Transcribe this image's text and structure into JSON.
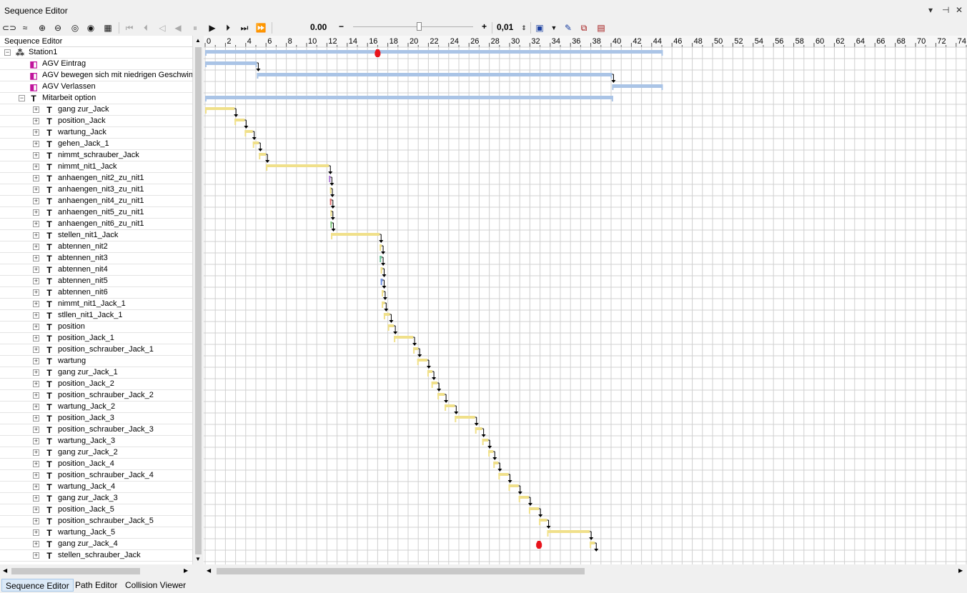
{
  "window": {
    "title": "Sequence Editor",
    "controls": [
      "▾",
      "⊣",
      "✕"
    ]
  },
  "toolbar": {
    "time_value": "0.00",
    "minus_label": "−",
    "plus_label": "+",
    "step_value": "0,01"
  },
  "tree": {
    "header": "Sequence Editor",
    "rows": [
      {
        "label": "Station1",
        "icon": "station-icon",
        "indent": 0,
        "exp": "−"
      },
      {
        "label": "AGV Eintrag",
        "icon": "agv-operation-icon",
        "indent": 2,
        "exp": ""
      },
      {
        "label": "AGV bewegen sich mit niedrigen Geschwin",
        "icon": "agv-operation-icon",
        "indent": 2,
        "exp": ""
      },
      {
        "label": "AGV Verlassen",
        "icon": "agv-operation-icon",
        "indent": 2,
        "exp": ""
      },
      {
        "label": "Mitarbeit option",
        "icon": "task-icon",
        "indent": 1,
        "exp": "−"
      },
      {
        "label": "gang zur_Jack",
        "icon": "task-icon",
        "indent": 2,
        "exp": "+"
      },
      {
        "label": "position_Jack",
        "icon": "task-icon",
        "indent": 2,
        "exp": "+"
      },
      {
        "label": "wartung_Jack",
        "icon": "task-icon",
        "indent": 2,
        "exp": "+"
      },
      {
        "label": "gehen_Jack_1",
        "icon": "task-icon",
        "indent": 2,
        "exp": "+"
      },
      {
        "label": "nimmt_schrauber_Jack",
        "icon": "task-icon",
        "indent": 2,
        "exp": "+"
      },
      {
        "label": "nimmt_nit1_Jack",
        "icon": "task-icon",
        "indent": 2,
        "exp": "+"
      },
      {
        "label": "anhaengen_nit2_zu_nit1",
        "icon": "task-icon",
        "indent": 2,
        "exp": "+"
      },
      {
        "label": "anhaengen_nit3_zu_nit1",
        "icon": "task-icon",
        "indent": 2,
        "exp": "+"
      },
      {
        "label": "anhaengen_nit4_zu_nit1",
        "icon": "task-icon",
        "indent": 2,
        "exp": "+"
      },
      {
        "label": "anhaengen_nit5_zu_nit1",
        "icon": "task-icon",
        "indent": 2,
        "exp": "+"
      },
      {
        "label": "anhaengen_nit6_zu_nit1",
        "icon": "task-icon",
        "indent": 2,
        "exp": "+"
      },
      {
        "label": "stellen_nit1_Jack",
        "icon": "task-icon",
        "indent": 2,
        "exp": "+"
      },
      {
        "label": "abtennen_nit2",
        "icon": "task-icon",
        "indent": 2,
        "exp": "+"
      },
      {
        "label": "abtennen_nit3",
        "icon": "task-icon",
        "indent": 2,
        "exp": "+"
      },
      {
        "label": "abtennen_nit4",
        "icon": "task-icon",
        "indent": 2,
        "exp": "+"
      },
      {
        "label": "abtennen_nit5",
        "icon": "task-icon",
        "indent": 2,
        "exp": "+"
      },
      {
        "label": "abtennen_nit6",
        "icon": "task-icon",
        "indent": 2,
        "exp": "+"
      },
      {
        "label": "nimmt_nit1_Jack_1",
        "icon": "task-icon",
        "indent": 2,
        "exp": "+"
      },
      {
        "label": "stllen_nit1_Jack_1",
        "icon": "task-icon",
        "indent": 2,
        "exp": "+"
      },
      {
        "label": "position",
        "icon": "task-icon",
        "indent": 2,
        "exp": "+"
      },
      {
        "label": "position_Jack_1",
        "icon": "task-icon",
        "indent": 2,
        "exp": "+"
      },
      {
        "label": "position_schrauber_Jack_1",
        "icon": "task-icon",
        "indent": 2,
        "exp": "+"
      },
      {
        "label": "wartung",
        "icon": "task-icon",
        "indent": 2,
        "exp": "+"
      },
      {
        "label": "gang zur_Jack_1",
        "icon": "task-icon",
        "indent": 2,
        "exp": "+"
      },
      {
        "label": "position_Jack_2",
        "icon": "task-icon",
        "indent": 2,
        "exp": "+"
      },
      {
        "label": "position_schrauber_Jack_2",
        "icon": "task-icon",
        "indent": 2,
        "exp": "+"
      },
      {
        "label": "wartung_Jack_2",
        "icon": "task-icon",
        "indent": 2,
        "exp": "+"
      },
      {
        "label": "position_Jack_3",
        "icon": "task-icon",
        "indent": 2,
        "exp": "+"
      },
      {
        "label": "position_schrauber_Jack_3",
        "icon": "task-icon",
        "indent": 2,
        "exp": "+"
      },
      {
        "label": "wartung_Jack_3",
        "icon": "task-icon",
        "indent": 2,
        "exp": "+"
      },
      {
        "label": "gang zur_Jack_2",
        "icon": "task-icon",
        "indent": 2,
        "exp": "+"
      },
      {
        "label": "position_Jack_4",
        "icon": "task-icon",
        "indent": 2,
        "exp": "+"
      },
      {
        "label": "position_schrauber_Jack_4",
        "icon": "task-icon",
        "indent": 2,
        "exp": "+"
      },
      {
        "label": "wartung_Jack_4",
        "icon": "task-icon",
        "indent": 2,
        "exp": "+"
      },
      {
        "label": "gang zur_Jack_3",
        "icon": "task-icon",
        "indent": 2,
        "exp": "+"
      },
      {
        "label": "position_Jack_5",
        "icon": "task-icon",
        "indent": 2,
        "exp": "+"
      },
      {
        "label": "position_schrauber_Jack_5",
        "icon": "task-icon",
        "indent": 2,
        "exp": "+"
      },
      {
        "label": "wartung_Jack_5",
        "icon": "task-icon",
        "indent": 2,
        "exp": "+"
      },
      {
        "label": "gang zur_Jack_4",
        "icon": "task-icon",
        "indent": 2,
        "exp": "+"
      },
      {
        "label": "stellen_schrauber_Jack",
        "icon": "task-icon",
        "indent": 2,
        "exp": "+"
      }
    ]
  },
  "gantt": {
    "ruler_ticks": [
      0,
      2,
      4,
      6,
      8,
      10,
      12,
      14,
      16,
      18,
      20,
      22,
      24,
      26,
      28,
      30,
      32,
      34,
      36,
      38,
      40,
      42,
      44,
      46,
      48,
      50,
      52,
      54,
      56,
      58,
      60,
      62,
      64,
      66,
      68,
      70,
      72,
      74
    ],
    "colors": {
      "summary": "#aac4e6",
      "task": "#f0e08a",
      "marker": "#e8141c",
      "grid": "#d0d0d0"
    },
    "bars": [
      {
        "row": 0,
        "start": 0,
        "end": 45.1,
        "kind": "summary"
      },
      {
        "row": 1,
        "start": 0,
        "end": 5.1,
        "kind": "summary"
      },
      {
        "row": 2,
        "start": 5.1,
        "end": 40.1,
        "kind": "summary"
      },
      {
        "row": 3,
        "start": 40.1,
        "end": 45.1,
        "kind": "summary"
      },
      {
        "row": 4,
        "start": 0,
        "end": 40.2,
        "kind": "summary"
      },
      {
        "row": 5,
        "start": 0,
        "end": 2.9,
        "kind": "task"
      },
      {
        "row": 6,
        "start": 2.9,
        "end": 3.9,
        "kind": "task"
      },
      {
        "row": 7,
        "start": 3.9,
        "end": 4.7,
        "kind": "task"
      },
      {
        "row": 8,
        "start": 4.7,
        "end": 5.3,
        "kind": "task"
      },
      {
        "row": 9,
        "start": 5.3,
        "end": 6.0,
        "kind": "task"
      },
      {
        "row": 10,
        "start": 6.0,
        "end": 12.2,
        "kind": "task"
      },
      {
        "row": 11,
        "start": 12.2,
        "end": 12.35,
        "kind": "task",
        "color": "#b07ad8"
      },
      {
        "row": 12,
        "start": 12.3,
        "end": 12.4,
        "kind": "task"
      },
      {
        "row": 13,
        "start": 12.3,
        "end": 12.45,
        "kind": "task",
        "color": "#e07070"
      },
      {
        "row": 14,
        "start": 12.35,
        "end": 12.45,
        "kind": "task"
      },
      {
        "row": 15,
        "start": 12.35,
        "end": 12.5,
        "kind": "task",
        "color": "#80c880"
      },
      {
        "row": 16,
        "start": 12.4,
        "end": 17.2,
        "kind": "task"
      },
      {
        "row": 17,
        "start": 17.2,
        "end": 17.4,
        "kind": "task"
      },
      {
        "row": 18,
        "start": 17.2,
        "end": 17.4,
        "kind": "task",
        "color": "#70c8a0"
      },
      {
        "row": 19,
        "start": 17.3,
        "end": 17.5,
        "kind": "task"
      },
      {
        "row": 20,
        "start": 17.3,
        "end": 17.5,
        "kind": "task",
        "color": "#7090e0"
      },
      {
        "row": 21,
        "start": 17.4,
        "end": 17.6,
        "kind": "task"
      },
      {
        "row": 22,
        "start": 17.4,
        "end": 17.7,
        "kind": "task"
      },
      {
        "row": 23,
        "start": 17.6,
        "end": 18.2,
        "kind": "task"
      },
      {
        "row": 24,
        "start": 18.0,
        "end": 18.6,
        "kind": "task"
      },
      {
        "row": 25,
        "start": 18.6,
        "end": 20.5,
        "kind": "task"
      },
      {
        "row": 26,
        "start": 20.5,
        "end": 21.0,
        "kind": "task"
      },
      {
        "row": 27,
        "start": 20.9,
        "end": 21.9,
        "kind": "task"
      },
      {
        "row": 28,
        "start": 21.9,
        "end": 22.4,
        "kind": "task"
      },
      {
        "row": 29,
        "start": 22.3,
        "end": 22.9,
        "kind": "task"
      },
      {
        "row": 30,
        "start": 22.9,
        "end": 23.6,
        "kind": "task"
      },
      {
        "row": 31,
        "start": 23.6,
        "end": 24.6,
        "kind": "task"
      },
      {
        "row": 32,
        "start": 24.6,
        "end": 26.6,
        "kind": "task"
      },
      {
        "row": 33,
        "start": 26.6,
        "end": 27.3,
        "kind": "task"
      },
      {
        "row": 34,
        "start": 27.3,
        "end": 27.9,
        "kind": "task"
      },
      {
        "row": 35,
        "start": 27.9,
        "end": 28.4,
        "kind": "task"
      },
      {
        "row": 36,
        "start": 28.4,
        "end": 28.9,
        "kind": "task"
      },
      {
        "row": 37,
        "start": 28.9,
        "end": 29.9,
        "kind": "task"
      },
      {
        "row": 38,
        "start": 29.9,
        "end": 30.9,
        "kind": "task"
      },
      {
        "row": 39,
        "start": 30.9,
        "end": 31.9,
        "kind": "task"
      },
      {
        "row": 40,
        "start": 31.9,
        "end": 32.9,
        "kind": "task"
      },
      {
        "row": 41,
        "start": 32.9,
        "end": 33.7,
        "kind": "task"
      },
      {
        "row": 42,
        "start": 33.7,
        "end": 37.9,
        "kind": "task"
      },
      {
        "row": 43,
        "start": 37.9,
        "end": 38.4,
        "kind": "task"
      }
    ],
    "markers": [
      {
        "row": 0,
        "t": 17.0
      },
      {
        "row": 43,
        "t": 32.9
      }
    ]
  },
  "tabs": [
    "Sequence Editor",
    "Path Editor",
    "Collision Viewer"
  ]
}
